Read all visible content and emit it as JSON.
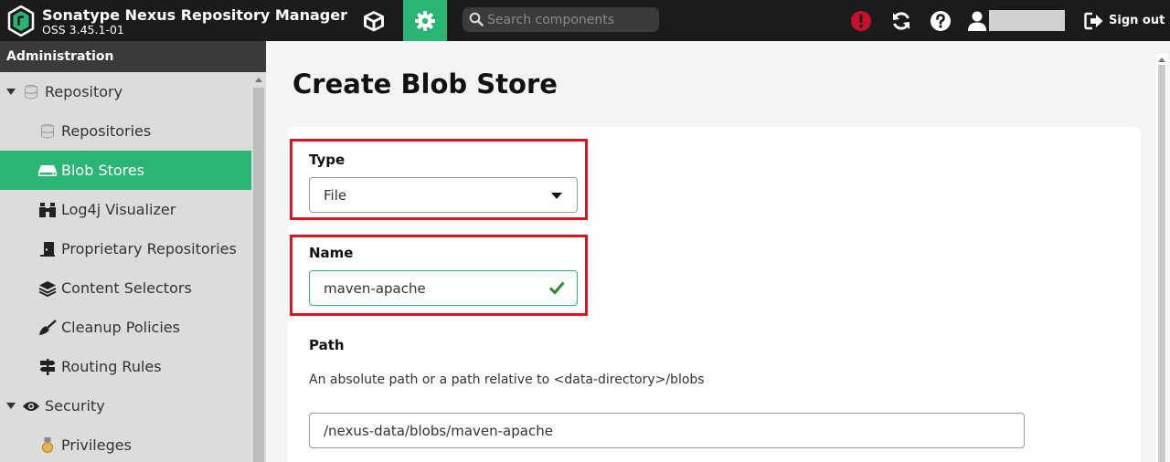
{
  "header": {
    "app_title": "Sonatype Nexus Repository Manager",
    "version": "OSS 3.45.1-01",
    "search_placeholder": "Search components",
    "sign_out_label": "Sign out"
  },
  "sidebar": {
    "heading": "Administration",
    "items": [
      {
        "label": "Repository",
        "icon": "database-icon",
        "type": "group"
      },
      {
        "label": "Repositories",
        "icon": "database-icon",
        "type": "child"
      },
      {
        "label": "Blob Stores",
        "icon": "hard-drive-icon",
        "type": "child",
        "active": true
      },
      {
        "label": "Log4j Visualizer",
        "icon": "binoculars-icon",
        "type": "child"
      },
      {
        "label": "Proprietary Repositories",
        "icon": "door-icon",
        "type": "child"
      },
      {
        "label": "Content Selectors",
        "icon": "layers-icon",
        "type": "child"
      },
      {
        "label": "Cleanup Policies",
        "icon": "broom-icon",
        "type": "child"
      },
      {
        "label": "Routing Rules",
        "icon": "signpost-icon",
        "type": "child"
      },
      {
        "label": "Security",
        "icon": "eye-icon",
        "type": "group"
      },
      {
        "label": "Privileges",
        "icon": "medal-icon",
        "type": "child"
      }
    ]
  },
  "main": {
    "title": "Create Blob Store",
    "type_label": "Type",
    "type_value": "File",
    "name_label": "Name",
    "name_value": "maven-apache",
    "path_label": "Path",
    "path_help": "An absolute path or a path relative to <data-directory>/blobs",
    "path_value": "/nexus-data/blobs/maven-apache"
  },
  "colors": {
    "accent": "#2ab574",
    "header_bg": "#1b1b1b",
    "highlight": "#e0141e",
    "alert": "#c8102e"
  }
}
